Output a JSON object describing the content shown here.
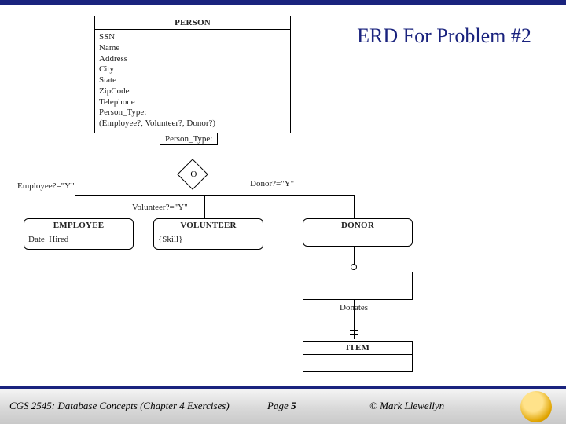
{
  "title": "ERD For Problem #2",
  "entities": {
    "person": {
      "name": "PERSON",
      "attrs": [
        "SSN",
        "Name",
        "Address",
        "City",
        "State",
        "ZipCode",
        "Telephone",
        "Person_Type:",
        "(Employee?, Volunteer?, Donor?)"
      ]
    },
    "employee": {
      "name": "EMPLOYEE",
      "attrs": [
        "Date_Hired"
      ]
    },
    "volunteer": {
      "name": "VOLUNTEER",
      "attrs": [
        "{Skill}"
      ]
    },
    "donor": {
      "name": "DONOR",
      "attrs": []
    },
    "item": {
      "name": "ITEM",
      "attrs": []
    },
    "relDonates": {
      "name": "",
      "attrs": [
        "Donates"
      ]
    }
  },
  "labels": {
    "discriminator": "Person_Type:",
    "gsym": "O",
    "condEmployee": "Employee?=\"Y\"",
    "condVolunteer": "Volunteer?=\"Y\"",
    "condDonor": "Donor?=\"Y\"",
    "donates": "Donates"
  },
  "footer": {
    "course": "CGS 2545: Database Concepts  (Chapter 4 Exercises)",
    "pageLabel": "Page",
    "pageNum": "5",
    "copyright": "© Mark Llewellyn"
  }
}
